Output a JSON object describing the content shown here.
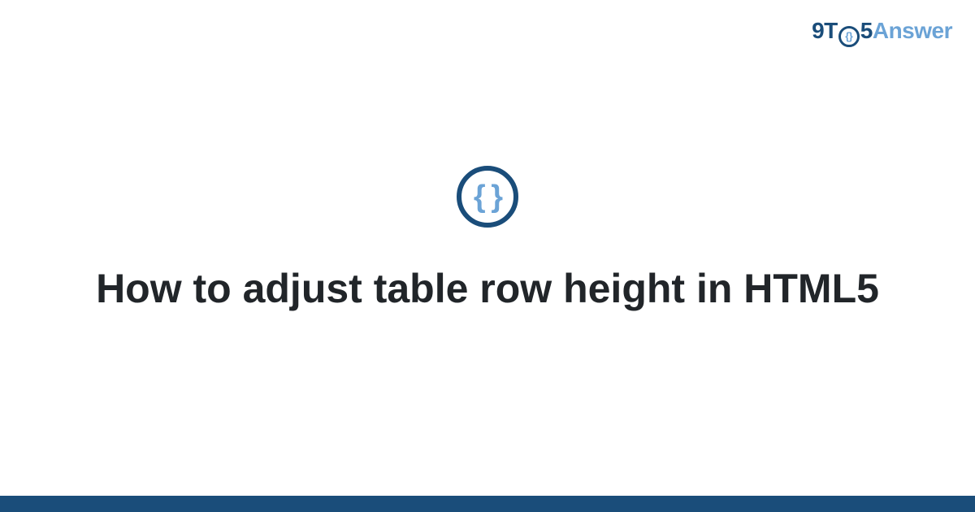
{
  "header": {
    "logo": {
      "prefix": "9T",
      "o_inner": "{}",
      "num5": "5",
      "suffix": "Answer"
    }
  },
  "icon": {
    "braces": "{ }"
  },
  "main": {
    "title": "How to adjust table row height in HTML5"
  },
  "colors": {
    "dark_blue": "#1a4d7a",
    "light_blue": "#6ba3d6",
    "text": "#212529"
  }
}
